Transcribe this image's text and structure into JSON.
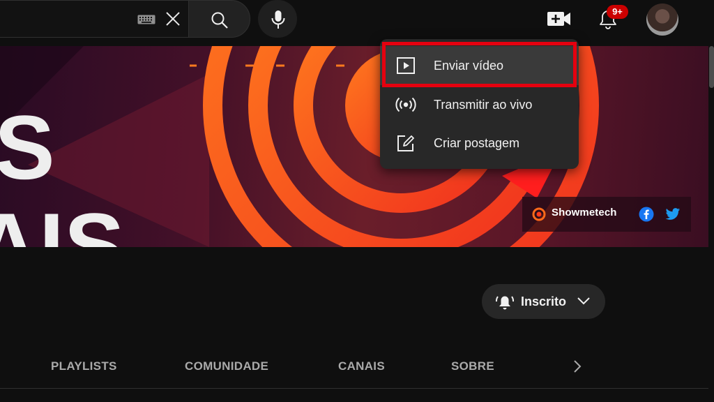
{
  "colors": {
    "background": "#0f0f0f",
    "menu_bg": "#282828",
    "highlight_border": "#e5000f",
    "notification_badge": "#cc0000",
    "banner_orange": "#ff6a1a"
  },
  "topbar": {
    "keyboard_icon": "keyboard-icon",
    "clear_icon": "close-icon",
    "search_icon": "search-icon",
    "mic_icon": "microphone-icon",
    "create_icon": "video-camera-plus-icon",
    "notifications_icon": "bell-icon",
    "notifications_badge": "9+",
    "avatar_icon": "user-avatar"
  },
  "banner": {
    "letter_1": "S",
    "letter_2": "AIS",
    "brand_name": "Showmetech",
    "facebook_icon": "facebook-icon",
    "twitter_icon": "twitter-icon"
  },
  "create_menu": {
    "items": [
      {
        "label": "Enviar vídeo",
        "icon": "play-square-icon",
        "highlighted": true
      },
      {
        "label": "Transmitir ao vivo",
        "icon": "live-broadcast-icon",
        "highlighted": false
      },
      {
        "label": "Criar postagem",
        "icon": "edit-post-icon",
        "highlighted": false
      }
    ]
  },
  "channel": {
    "subscribe_label": "Inscrito",
    "subscribe_bell_icon": "bell-ringing-icon",
    "subscribe_chevron_icon": "chevron-down-icon"
  },
  "tabs": {
    "items": [
      {
        "label": "PLAYLISTS"
      },
      {
        "label": "COMUNIDADE"
      },
      {
        "label": "CANAIS"
      },
      {
        "label": "SOBRE"
      }
    ],
    "next_icon": "chevron-right-icon"
  }
}
